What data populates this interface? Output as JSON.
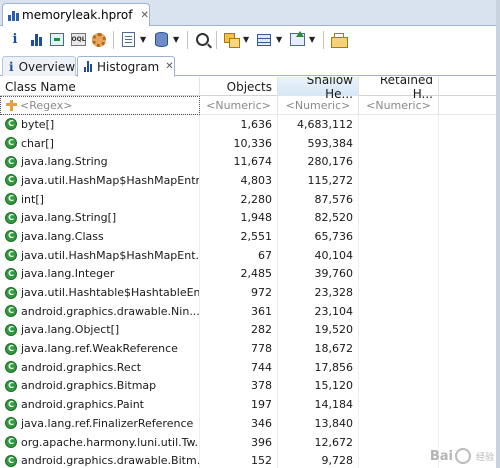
{
  "editor_tab": {
    "title": "memoryleak.hprof",
    "close": "✕"
  },
  "toolbar": {
    "items": [
      "info-icon",
      "histogram-icon",
      "dominator-tree-icon",
      "oql-icon",
      "gear-icon",
      "report-icon",
      "database-icon",
      "search-icon",
      "group-icon",
      "table-icon",
      "export-icon",
      "compare-icon"
    ]
  },
  "view_tabs": [
    {
      "label": "Overview"
    },
    {
      "label": "Histogram",
      "active": true,
      "close": "✕"
    }
  ],
  "table": {
    "headers": [
      "Class Name",
      "Objects",
      "Shallow He...",
      "Retained H..."
    ],
    "sorted_column": "Shallow He...",
    "filters": {
      "name": "<Regex>",
      "objects": "<Numeric>",
      "shallow": "<Numeric>",
      "retained": "<Numeric>"
    },
    "class_icon_letter": "C",
    "rows": [
      {
        "name": "byte[]",
        "objects": "1,636",
        "shallow": "4,683,112"
      },
      {
        "name": "char[]",
        "objects": "10,336",
        "shallow": "593,384"
      },
      {
        "name": "java.lang.String",
        "objects": "11,674",
        "shallow": "280,176"
      },
      {
        "name": "java.util.HashMap$HashMapEntry",
        "objects": "4,803",
        "shallow": "115,272"
      },
      {
        "name": "int[]",
        "objects": "2,280",
        "shallow": "87,576"
      },
      {
        "name": "java.lang.String[]",
        "objects": "1,948",
        "shallow": "82,520"
      },
      {
        "name": "java.lang.Class",
        "objects": "2,551",
        "shallow": "65,736"
      },
      {
        "name": "java.util.HashMap$HashMapEnt...",
        "objects": "67",
        "shallow": "40,104"
      },
      {
        "name": "java.lang.Integer",
        "objects": "2,485",
        "shallow": "39,760"
      },
      {
        "name": "java.util.Hashtable$HashtableEn...",
        "objects": "972",
        "shallow": "23,328"
      },
      {
        "name": "android.graphics.drawable.Nin...",
        "objects": "361",
        "shallow": "23,104"
      },
      {
        "name": "java.lang.Object[]",
        "objects": "282",
        "shallow": "19,520"
      },
      {
        "name": "java.lang.ref.WeakReference",
        "objects": "778",
        "shallow": "18,672"
      },
      {
        "name": "android.graphics.Rect",
        "objects": "744",
        "shallow": "17,856"
      },
      {
        "name": "android.graphics.Bitmap",
        "objects": "378",
        "shallow": "15,120"
      },
      {
        "name": "android.graphics.Paint",
        "objects": "197",
        "shallow": "14,184"
      },
      {
        "name": "java.lang.ref.FinalizerReference",
        "objects": "346",
        "shallow": "13,840"
      },
      {
        "name": "org.apache.harmony.luni.util.Tw...",
        "objects": "396",
        "shallow": "12,672"
      },
      {
        "name": "android.graphics.drawable.Bitm...",
        "objects": "152",
        "shallow": "9,728"
      }
    ]
  },
  "watermark": {
    "text": "Bai",
    "suffix": "经验"
  }
}
